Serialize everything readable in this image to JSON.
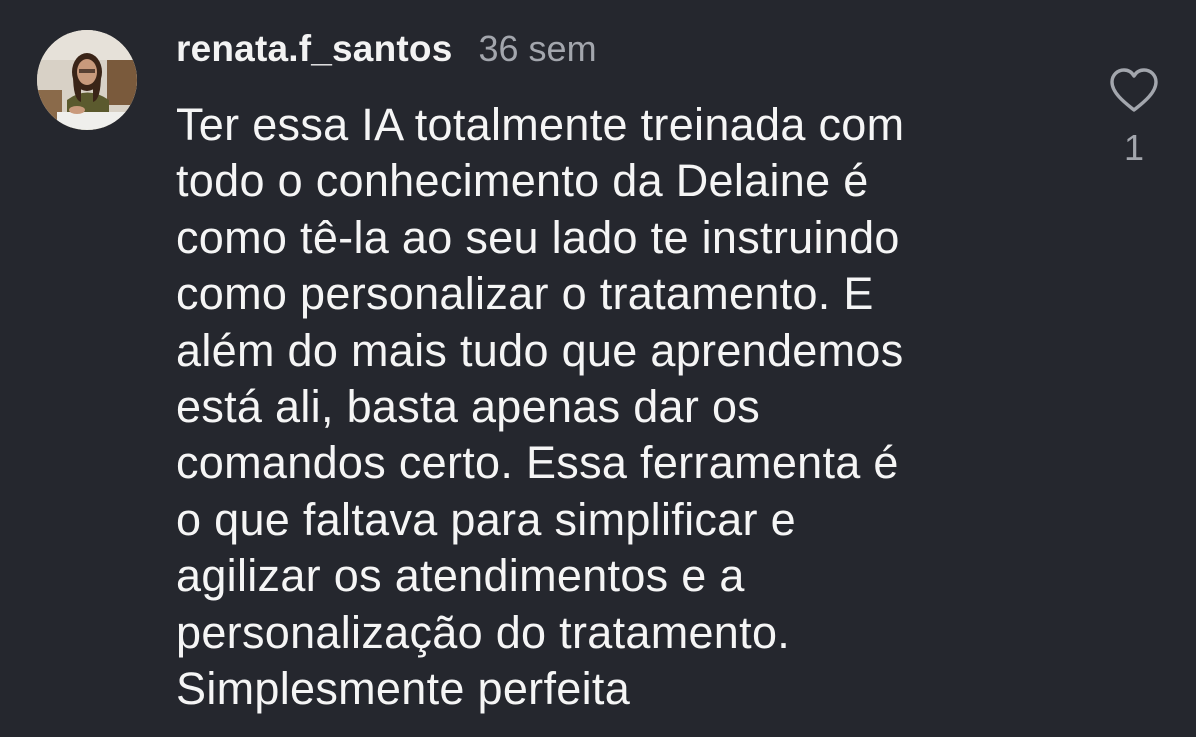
{
  "comment": {
    "username": "renata.f_santos",
    "time": "36 sem",
    "lines": [
      "Ter essa IA totalmente treinada com",
      "todo o conhecimento da Delaine é",
      "como tê-la ao seu lado te instruindo",
      "como personalizar o tratamento. E",
      "além do mais tudo que aprendemos",
      "está ali, basta apenas dar os",
      "comandos certo. Essa ferramenta é",
      "o que faltava para simplificar e",
      "agilizar os atendimentos e a",
      "personalização do tratamento.",
      "Simplesmente perfeita"
    ],
    "like_count": "1",
    "like_icon": "heart-outline-icon"
  },
  "colors": {
    "background": "#25272e",
    "text": "#f5f5f5",
    "muted": "#a3a6ad"
  }
}
